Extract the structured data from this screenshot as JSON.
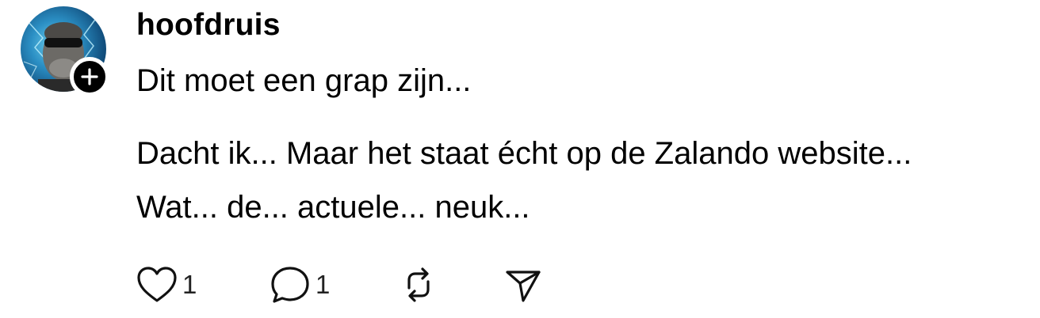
{
  "post": {
    "username": "hoofdruis",
    "lines": [
      "Dit moet een grap zijn...",
      "Dacht ik... Maar het staat écht op de Zalando website...",
      "Wat... de... actuele... neuk..."
    ],
    "actions": {
      "like_count": "1",
      "reply_count": "1"
    },
    "icons": {
      "follow": "plus-icon",
      "like": "heart-icon",
      "reply": "comment-icon",
      "repost": "repost-icon",
      "share": "send-icon"
    },
    "colors": {
      "text": "#000000",
      "badge": "#000000",
      "avatar_accent": "#2b8fc4"
    }
  }
}
